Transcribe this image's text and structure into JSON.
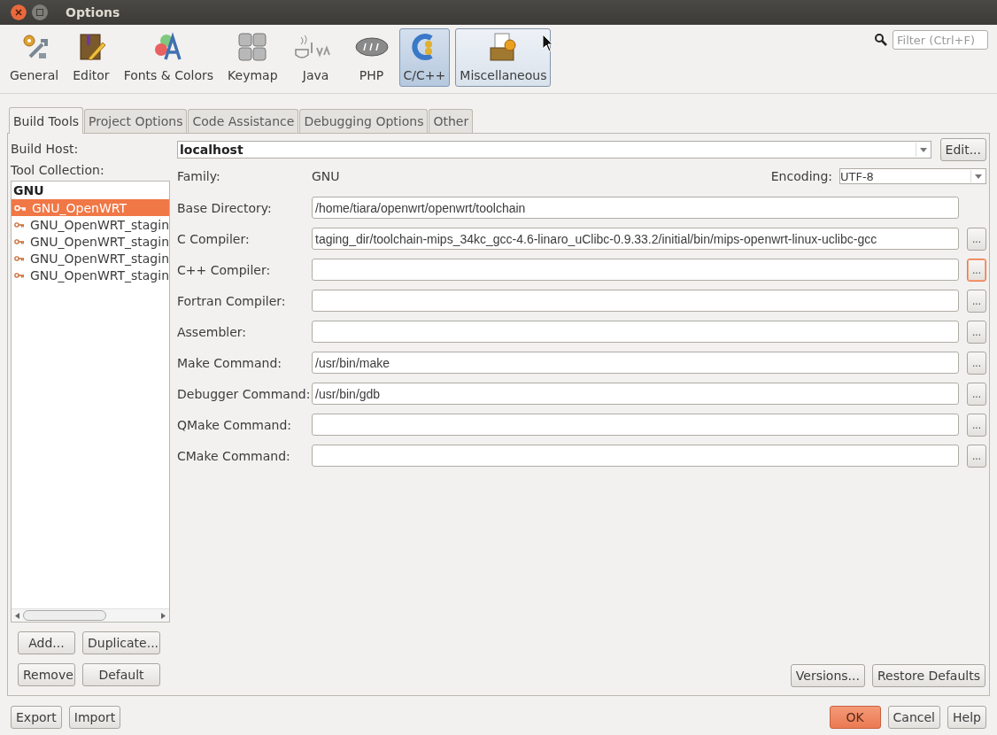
{
  "window": {
    "title": "Options"
  },
  "categories": [
    {
      "label": "General",
      "selected": false,
      "hovered": false
    },
    {
      "label": "Editor",
      "selected": false,
      "hovered": false
    },
    {
      "label": "Fonts & Colors",
      "selected": false,
      "hovered": false
    },
    {
      "label": "Keymap",
      "selected": false,
      "hovered": false
    },
    {
      "label": "Java",
      "selected": false,
      "hovered": false
    },
    {
      "label": "PHP",
      "selected": false,
      "hovered": false
    },
    {
      "label": "C/C++",
      "selected": true,
      "hovered": false
    },
    {
      "label": "Miscellaneous",
      "selected": false,
      "hovered": true
    }
  ],
  "filter": {
    "placeholder": "Filter (Ctrl+F)"
  },
  "tabs": [
    {
      "label": "Build Tools",
      "selected": true
    },
    {
      "label": "Project Options",
      "selected": false
    },
    {
      "label": "Code Assistance",
      "selected": false
    },
    {
      "label": "Debugging Options",
      "selected": false
    },
    {
      "label": "Other",
      "selected": false
    }
  ],
  "build_host": {
    "label": "Build Host:",
    "value": "localhost",
    "edit_button": "Edit..."
  },
  "tool_collection": {
    "label": "Tool Collection:",
    "group": "GNU",
    "items": [
      {
        "label": "GNU_OpenWRT",
        "selected": true
      },
      {
        "label": "GNU_OpenWRT_stagin",
        "selected": false
      },
      {
        "label": "GNU_OpenWRT_stagin",
        "selected": false
      },
      {
        "label": "GNU_OpenWRT_stagin",
        "selected": false
      },
      {
        "label": "GNU_OpenWRT_stagin",
        "selected": false
      }
    ],
    "buttons": [
      "Add...",
      "Duplicate...",
      "Remove",
      "Default"
    ]
  },
  "family": {
    "label": "Family:",
    "value": "GNU"
  },
  "encoding": {
    "label": "Encoding:",
    "value": "UTF-8"
  },
  "tools": [
    {
      "label": "Base Directory:",
      "value": "/home/tiara/openwrt/openwrt/toolchain",
      "browse": false,
      "focused": false
    },
    {
      "label": "C Compiler:",
      "value": "taging_dir/toolchain-mips_34kc_gcc-4.6-linaro_uClibc-0.9.33.2/initial/bin/mips-openwrt-linux-uclibc-gcc",
      "browse": true,
      "focused": false
    },
    {
      "label": "C++ Compiler:",
      "browse": true,
      "focused": true
    },
    {
      "label": "Fortran Compiler:",
      "browse": true,
      "focused": false
    },
    {
      "label": "Assembler:",
      "browse": true,
      "focused": false
    },
    {
      "label": "Make Command:",
      "value": "/usr/bin/make",
      "browse": true,
      "focused": false
    },
    {
      "label": "Debugger Command:",
      "value": "/usr/bin/gdb",
      "browse": true,
      "focused": false
    },
    {
      "label": "QMake Command:",
      "browse": true,
      "focused": false
    },
    {
      "label": "CMake Command:",
      "browse": true,
      "focused": false
    }
  ],
  "browse_label": "...",
  "panel_buttons": [
    "Versions...",
    "Restore Defaults"
  ],
  "footer_left": [
    "Export",
    "Import"
  ],
  "footer_right": [
    {
      "label": "OK",
      "kind": "primary"
    },
    {
      "label": "Cancel",
      "kind": "normal"
    },
    {
      "label": "Help",
      "kind": "normal"
    }
  ]
}
